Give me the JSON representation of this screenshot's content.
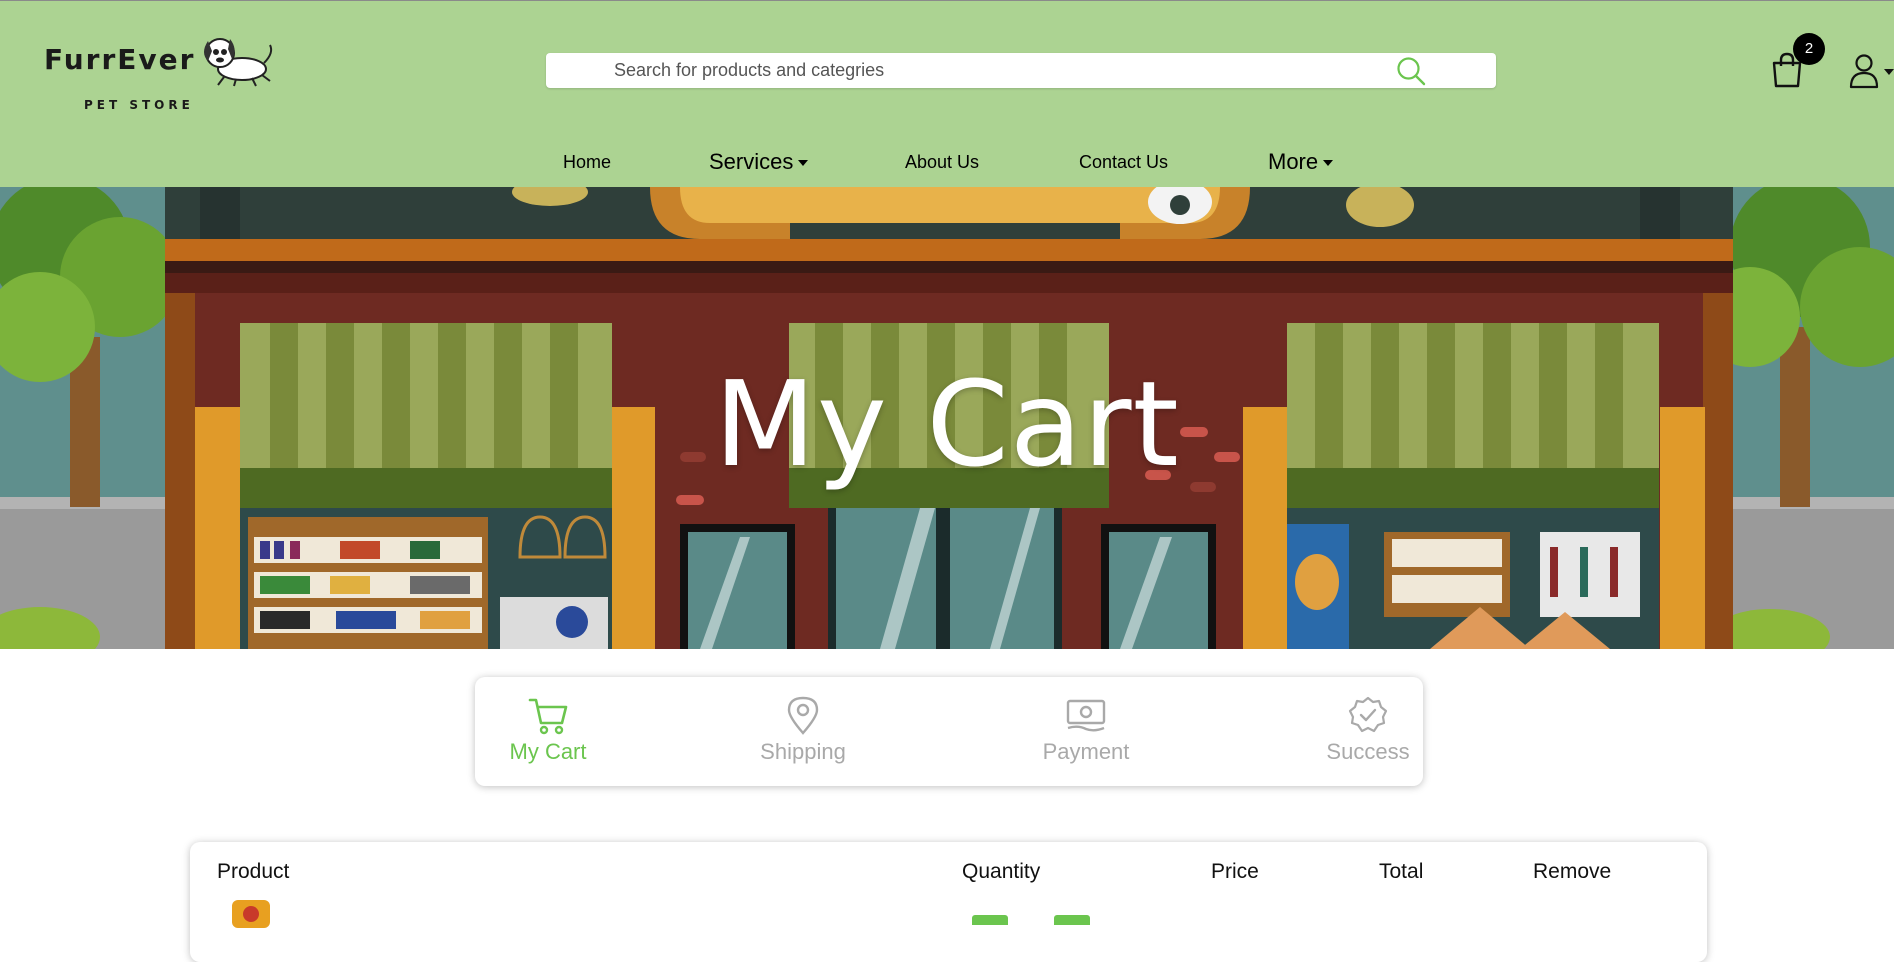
{
  "brand": {
    "name": "FurrEver",
    "tagline": "PET STORE"
  },
  "search": {
    "placeholder": "Search for products and categries"
  },
  "cart": {
    "count": "2"
  },
  "nav": {
    "home": "Home",
    "services": "Services",
    "about": "About Us",
    "contact": "Contact Us",
    "more": "More"
  },
  "hero": {
    "title": "My Cart"
  },
  "steps": [
    {
      "label": "My Cart",
      "icon": "cart-icon",
      "state": "active"
    },
    {
      "label": "Shipping",
      "icon": "location-pin-icon",
      "state": "inactive"
    },
    {
      "label": "Payment",
      "icon": "cash-icon",
      "state": "inactive"
    },
    {
      "label": "Success",
      "icon": "check-badge-icon",
      "state": "inactive"
    }
  ],
  "table": {
    "headers": {
      "product": "Product",
      "quantity": "Quantity",
      "price": "Price",
      "total": "Total",
      "remove": "Remove"
    }
  },
  "colors": {
    "header_bg": "#acd392",
    "accent": "#6bc54e",
    "inactive": "#a9a9a9"
  }
}
